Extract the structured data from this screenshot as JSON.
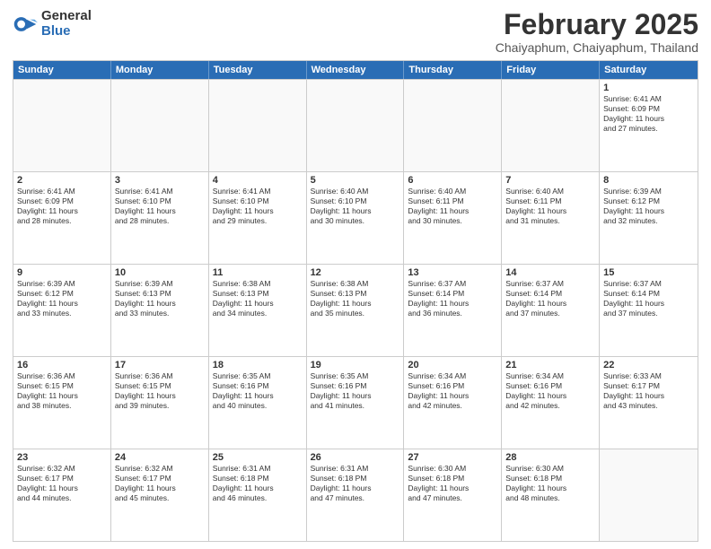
{
  "logo": {
    "general": "General",
    "blue": "Blue"
  },
  "title": "February 2025",
  "location": "Chaiyaphum, Chaiyaphum, Thailand",
  "weekdays": [
    "Sunday",
    "Monday",
    "Tuesday",
    "Wednesday",
    "Thursday",
    "Friday",
    "Saturday"
  ],
  "weeks": [
    [
      {
        "day": "",
        "info": ""
      },
      {
        "day": "",
        "info": ""
      },
      {
        "day": "",
        "info": ""
      },
      {
        "day": "",
        "info": ""
      },
      {
        "day": "",
        "info": ""
      },
      {
        "day": "",
        "info": ""
      },
      {
        "day": "1",
        "info": "Sunrise: 6:41 AM\nSunset: 6:09 PM\nDaylight: 11 hours\nand 27 minutes."
      }
    ],
    [
      {
        "day": "2",
        "info": "Sunrise: 6:41 AM\nSunset: 6:09 PM\nDaylight: 11 hours\nand 28 minutes."
      },
      {
        "day": "3",
        "info": "Sunrise: 6:41 AM\nSunset: 6:10 PM\nDaylight: 11 hours\nand 28 minutes."
      },
      {
        "day": "4",
        "info": "Sunrise: 6:41 AM\nSunset: 6:10 PM\nDaylight: 11 hours\nand 29 minutes."
      },
      {
        "day": "5",
        "info": "Sunrise: 6:40 AM\nSunset: 6:10 PM\nDaylight: 11 hours\nand 30 minutes."
      },
      {
        "day": "6",
        "info": "Sunrise: 6:40 AM\nSunset: 6:11 PM\nDaylight: 11 hours\nand 30 minutes."
      },
      {
        "day": "7",
        "info": "Sunrise: 6:40 AM\nSunset: 6:11 PM\nDaylight: 11 hours\nand 31 minutes."
      },
      {
        "day": "8",
        "info": "Sunrise: 6:39 AM\nSunset: 6:12 PM\nDaylight: 11 hours\nand 32 minutes."
      }
    ],
    [
      {
        "day": "9",
        "info": "Sunrise: 6:39 AM\nSunset: 6:12 PM\nDaylight: 11 hours\nand 33 minutes."
      },
      {
        "day": "10",
        "info": "Sunrise: 6:39 AM\nSunset: 6:13 PM\nDaylight: 11 hours\nand 33 minutes."
      },
      {
        "day": "11",
        "info": "Sunrise: 6:38 AM\nSunset: 6:13 PM\nDaylight: 11 hours\nand 34 minutes."
      },
      {
        "day": "12",
        "info": "Sunrise: 6:38 AM\nSunset: 6:13 PM\nDaylight: 11 hours\nand 35 minutes."
      },
      {
        "day": "13",
        "info": "Sunrise: 6:37 AM\nSunset: 6:14 PM\nDaylight: 11 hours\nand 36 minutes."
      },
      {
        "day": "14",
        "info": "Sunrise: 6:37 AM\nSunset: 6:14 PM\nDaylight: 11 hours\nand 37 minutes."
      },
      {
        "day": "15",
        "info": "Sunrise: 6:37 AM\nSunset: 6:14 PM\nDaylight: 11 hours\nand 37 minutes."
      }
    ],
    [
      {
        "day": "16",
        "info": "Sunrise: 6:36 AM\nSunset: 6:15 PM\nDaylight: 11 hours\nand 38 minutes."
      },
      {
        "day": "17",
        "info": "Sunrise: 6:36 AM\nSunset: 6:15 PM\nDaylight: 11 hours\nand 39 minutes."
      },
      {
        "day": "18",
        "info": "Sunrise: 6:35 AM\nSunset: 6:16 PM\nDaylight: 11 hours\nand 40 minutes."
      },
      {
        "day": "19",
        "info": "Sunrise: 6:35 AM\nSunset: 6:16 PM\nDaylight: 11 hours\nand 41 minutes."
      },
      {
        "day": "20",
        "info": "Sunrise: 6:34 AM\nSunset: 6:16 PM\nDaylight: 11 hours\nand 42 minutes."
      },
      {
        "day": "21",
        "info": "Sunrise: 6:34 AM\nSunset: 6:16 PM\nDaylight: 11 hours\nand 42 minutes."
      },
      {
        "day": "22",
        "info": "Sunrise: 6:33 AM\nSunset: 6:17 PM\nDaylight: 11 hours\nand 43 minutes."
      }
    ],
    [
      {
        "day": "23",
        "info": "Sunrise: 6:32 AM\nSunset: 6:17 PM\nDaylight: 11 hours\nand 44 minutes."
      },
      {
        "day": "24",
        "info": "Sunrise: 6:32 AM\nSunset: 6:17 PM\nDaylight: 11 hours\nand 45 minutes."
      },
      {
        "day": "25",
        "info": "Sunrise: 6:31 AM\nSunset: 6:18 PM\nDaylight: 11 hours\nand 46 minutes."
      },
      {
        "day": "26",
        "info": "Sunrise: 6:31 AM\nSunset: 6:18 PM\nDaylight: 11 hours\nand 47 minutes."
      },
      {
        "day": "27",
        "info": "Sunrise: 6:30 AM\nSunset: 6:18 PM\nDaylight: 11 hours\nand 47 minutes."
      },
      {
        "day": "28",
        "info": "Sunrise: 6:30 AM\nSunset: 6:18 PM\nDaylight: 11 hours\nand 48 minutes."
      },
      {
        "day": "",
        "info": ""
      }
    ]
  ]
}
